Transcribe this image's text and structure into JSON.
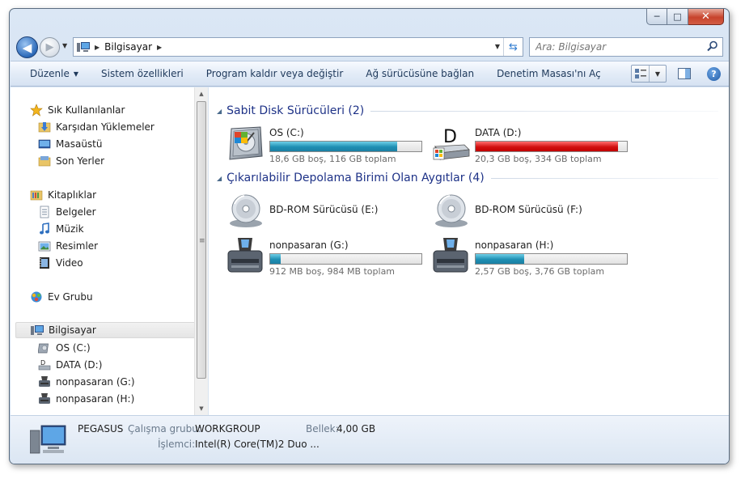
{
  "window": {
    "caption_buttons": {
      "minimize": "─",
      "maximize": "□",
      "close": "✕"
    },
    "colors": {
      "accent": "#1e3287",
      "bar_blue": "#1f8fb3",
      "bar_red": "#d10f0f",
      "close_red": "#c7432c"
    }
  },
  "address": {
    "path": "Bilgisayar",
    "back_icon": "arrow-left-icon",
    "forward_icon": "arrow-right-icon",
    "refresh_icon": "refresh-icon"
  },
  "search": {
    "placeholder": "Ara: Bilgisayar",
    "icon": "search-icon"
  },
  "toolbar": {
    "organize": "Düzenle",
    "system_properties": "Sistem özellikleri",
    "uninstall": "Program kaldır veya değiştir",
    "map_drive": "Ağ sürücüsüne bağlan",
    "control_panel": "Denetim Masası'nı Aç",
    "help": "?"
  },
  "sidebar": {
    "favorites": "Sık Kullanılanlar",
    "downloads": "Karşıdan Yüklemeler",
    "desktop": "Masaüstü",
    "recent": "Son Yerler",
    "libraries": "Kitaplıklar",
    "documents": "Belgeler",
    "music": "Müzik",
    "pictures": "Resimler",
    "videos": "Video",
    "homegroup": "Ev Grubu",
    "computer": "Bilgisayar",
    "drive_c": "OS (C:)",
    "drive_d": "DATA (D:)",
    "drive_g": "nonpasaran (G:)",
    "drive_h": "nonpasaran (H:)"
  },
  "groups": {
    "hard_disks": "Sabit Disk Sürücüleri (2)",
    "removable": "Çıkarılabilir Depolama Birimi Olan Aygıtlar (4)"
  },
  "drives": {
    "c": {
      "name": "OS (C:)",
      "info": "18,6 GB boş, 116 GB toplam",
      "used_fraction": 0.84
    },
    "d": {
      "name": "DATA (D:)",
      "info": "20,3 GB boş, 334 GB toplam",
      "used_fraction": 0.94,
      "icon_letter": "D"
    },
    "e": {
      "name": "BD-ROM Sürücüsü (E:)"
    },
    "f": {
      "name": "BD-ROM Sürücüsü (F:)"
    },
    "g": {
      "name": "nonpasaran (G:)",
      "info": "912 MB boş, 984 MB toplam",
      "used_fraction": 0.07
    },
    "h": {
      "name": "nonpasaran (H:)",
      "info": "2,57 GB boş, 3,76 GB toplam",
      "used_fraction": 0.32
    }
  },
  "details": {
    "computer_name": "PEGASUS",
    "workgroup_label": "Çalışma grubu:",
    "workgroup_value": "WORKGROUP",
    "memory_label": "Bellek:",
    "memory_value": "4,00 GB",
    "processor_label": "İşlemci:",
    "processor_value": "Intel(R) Core(TM)2 Duo ..."
  }
}
